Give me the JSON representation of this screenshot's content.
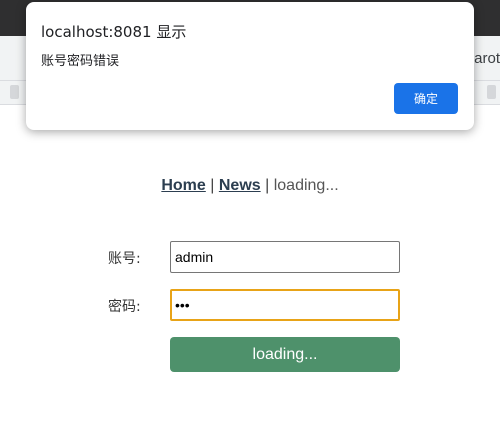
{
  "browser": {
    "toolbar_text": "arot"
  },
  "dialog": {
    "title": "localhost:8081 显示",
    "message": "账号密码错误",
    "ok_label": "确定"
  },
  "nav": {
    "home_label": "Home",
    "separator": "|",
    "news_label": "News",
    "status_text": "loading..."
  },
  "form": {
    "username_label": "账号:",
    "username_value": "admin",
    "password_label": "密码:",
    "password_value": "•••",
    "submit_label": "loading..."
  },
  "colors": {
    "accent_button": "#1a73e8",
    "submit_button": "#4e916b",
    "focus_border": "#e8a317"
  }
}
